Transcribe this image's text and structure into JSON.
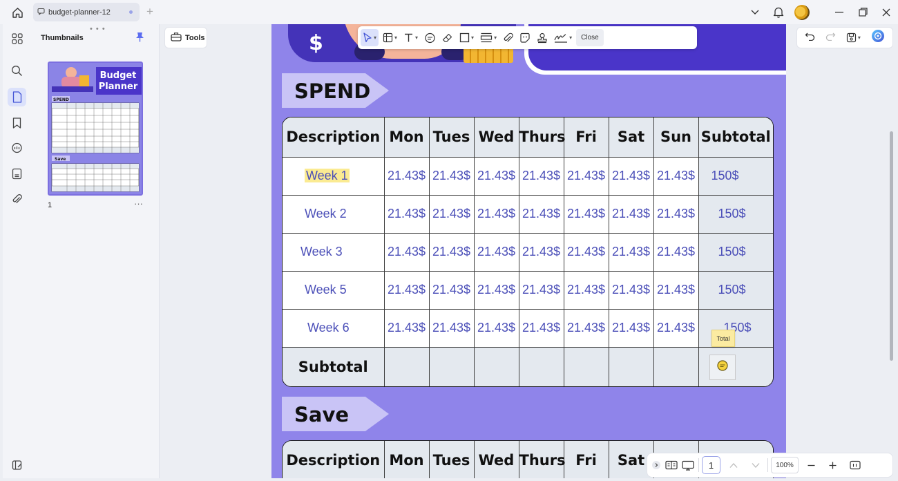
{
  "titlebar": {
    "tab_title": "budget-planner-12"
  },
  "thumbnails": {
    "title": "Thumbnails",
    "page_number": "1",
    "more": "···",
    "preview_title_line1": "Budget",
    "preview_title_line2": "Planner",
    "preview_spend": "SPEND",
    "preview_save": "Save"
  },
  "toolbar": {
    "tools_label": "Tools",
    "close_label": "Close"
  },
  "document": {
    "spend_heading": "SPEND",
    "save_heading": "Save",
    "columns": [
      "Description",
      "Mon",
      "Tues",
      "Wed",
      "Thurs",
      "Fri",
      "Sat",
      "Sun",
      "Subtotal"
    ],
    "save_columns": [
      "Description",
      "Mon",
      "Tues",
      "Wed",
      "Thurs",
      "Fri",
      "Sat"
    ],
    "rows": [
      {
        "label": "Week 1",
        "values": [
          "21.43$",
          "21.43$",
          "21.43$",
          "21.43$",
          "21.43$",
          "21.43$",
          "21.43$"
        ],
        "subtotal": "150$"
      },
      {
        "label": "Week 2",
        "values": [
          "21.43$",
          "21.43$",
          "21.43$",
          "21.43$",
          "21.43$",
          "21.43$",
          "21.43$"
        ],
        "subtotal": "150$"
      },
      {
        "label": "Week 3",
        "values": [
          "21.43$",
          "21.43$",
          "21.43$",
          "21.43$",
          "21.43$",
          "21.43$",
          "21.43$"
        ],
        "subtotal": "150$"
      },
      {
        "label": "Week 5",
        "values": [
          "21.43$",
          "21.43$",
          "21.43$",
          "21.43$",
          "21.43$",
          "21.43$",
          "21.43$"
        ],
        "subtotal": "150$"
      },
      {
        "label": "Week 6",
        "values": [
          "21.43$",
          "21.43$",
          "21.43$",
          "21.43$",
          "21.43$",
          "21.43$",
          "21.43$"
        ],
        "subtotal": "150$"
      }
    ],
    "subtotal_label": "Subtotal",
    "sticky_note": "Total"
  },
  "bottom_bar": {
    "page": "1",
    "zoom": "100%"
  },
  "colors": {
    "accent": "#5b6cf0",
    "page_bg": "#8f84ea",
    "header_dark": "#4a35c9",
    "table_header": "#e4e9ef",
    "cell_text": "#4b4fb8",
    "highlight": "#fbeb92"
  }
}
